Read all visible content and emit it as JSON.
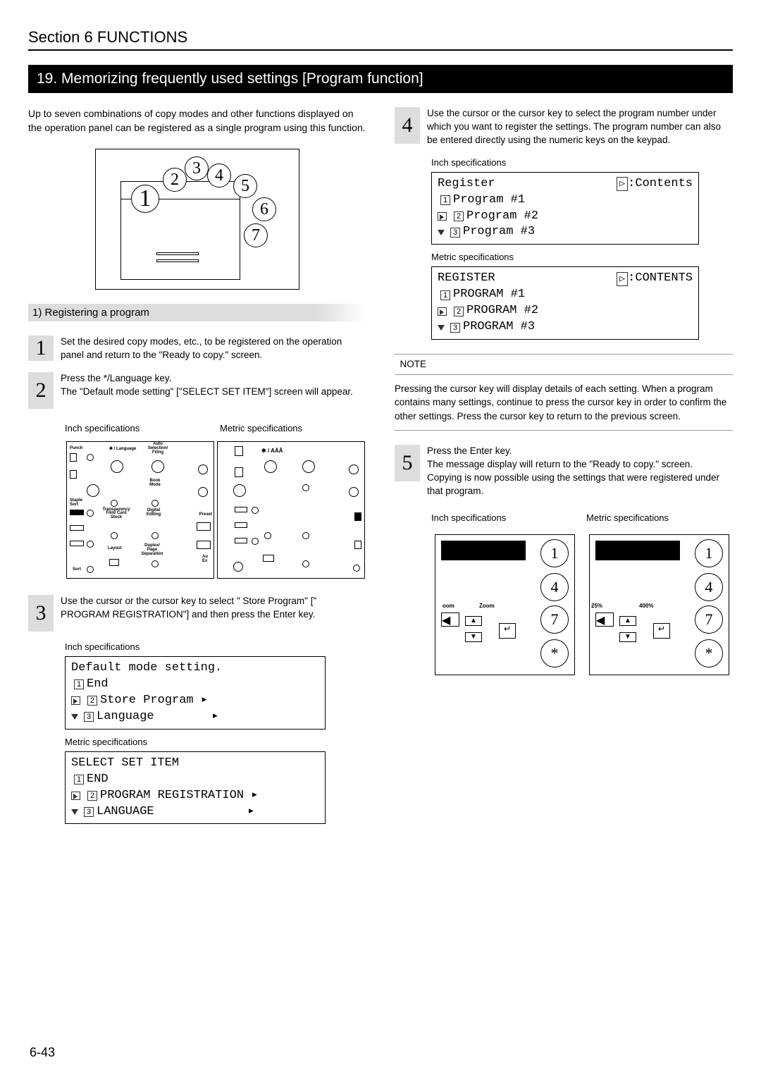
{
  "section": "Section 6  FUNCTIONS",
  "title": "19. Memorizing frequently used settings [Program function]",
  "intro": "Up to seven combinations of copy modes and other functions displayed on the operation panel can be registered as a single program using this function.",
  "subhead1": "1) Registering a program",
  "steps": {
    "s1": {
      "num": "1",
      "text": "Set the desired copy modes, etc., to be registered on the operation panel and return to the \"Ready to copy.\" screen."
    },
    "s2": {
      "num": "2",
      "text_a": "Press the */Language key.",
      "text_b": "The \"Default mode setting\" [\"SELECT SET ITEM\"] screen will appear."
    },
    "s3": {
      "num": "3",
      "text": "Use the       cursor or the       cursor key to select \"     Store Program\" [\"     PROGRAM REGISTRATION\"] and then press the Enter key."
    },
    "s4": {
      "num": "4",
      "text": "Use the       cursor or the       cursor key to select the program number under which you want to register the settings. The program number can also be entered directly using the numeric keys on the keypad."
    },
    "s5": {
      "num": "5",
      "text_a": "Press the Enter key.",
      "text_b": "The message display will return to the \"Ready to copy.\" screen.",
      "text_c": "Copying is now possible using the settings that were registered under that program."
    }
  },
  "labels": {
    "inch": "Inch specifications",
    "metric": "Metric specifications"
  },
  "lcd": {
    "inch1": {
      "title": "Default mode setting.",
      "i1": "End",
      "i2": "Store Program",
      "i3": "Language"
    },
    "metric1": {
      "title": "SELECT SET ITEM",
      "i1": "END",
      "i2": "PROGRAM REGISTRATION",
      "i3": "LANGUAGE"
    },
    "inch2": {
      "title": "Register",
      "right": ":Contents",
      "i1": "Program #1",
      "i2": "Program #2",
      "i3": "Program #3"
    },
    "metric2": {
      "title": "REGISTER",
      "right": ":CONTENTS",
      "i1": "PROGRAM #1",
      "i2": "PROGRAM #2",
      "i3": "PROGRAM #3"
    }
  },
  "note": {
    "label": "NOTE",
    "body": "Pressing the       cursor key will display details of each setting. When a program contains many settings, continue to press the       cursor key in order to confirm the other settings. Press the       cursor key to return to the previous screen."
  },
  "keypad": {
    "k1": "1",
    "k4": "4",
    "k7": "7",
    "kstar": "*",
    "zoom": "Zoom",
    "pc25": "25%",
    "pc400": "400%"
  },
  "bubbles": {
    "b1": "1",
    "b2": "2",
    "b3": "3",
    "b4": "4",
    "b5": "5",
    "b6": "6",
    "b7": "7"
  },
  "panel_text": {
    "punch": "Punch",
    "lang": "✱ / Language",
    "auto": "Auto Selection/ Filing",
    "staple": "Staple Sort",
    "book": "Book Mode",
    "trans": "Transparency Film/ Card Stock",
    "digital": "Digital Editing",
    "layout": "Layout",
    "duplex": "Duplex/ Page Separation",
    "sort": "Sort",
    "preset": "Preset",
    "auex": "Au Ex",
    "aaa": "✱ / AÄÅ"
  },
  "page": "6-43"
}
